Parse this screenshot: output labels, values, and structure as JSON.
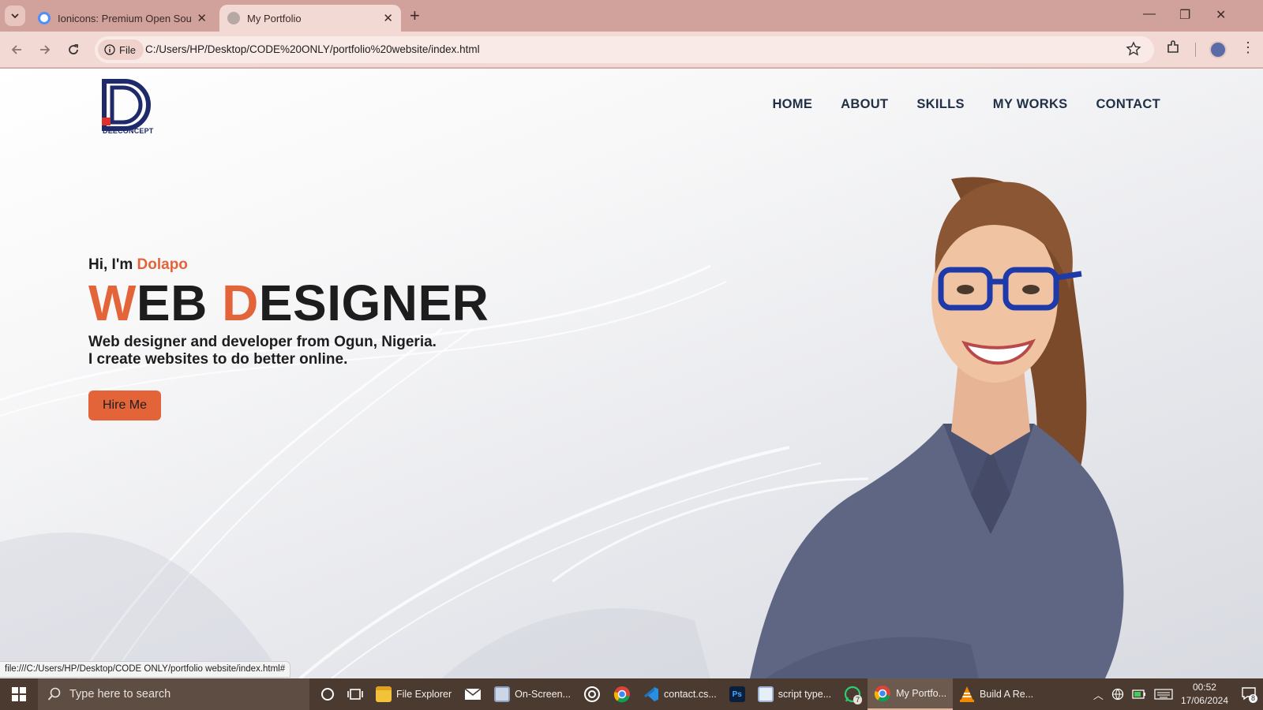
{
  "browser": {
    "tabs": [
      {
        "title": "Ionicons: Premium Open Source",
        "active": false
      },
      {
        "title": "My Portfolio",
        "active": true
      }
    ],
    "chip_label": "File",
    "url": "C:/Users/HP/Desktop/CODE%20ONLY/portfolio%20website/index.html",
    "status_url": "file:///C:/Users/HP/Desktop/CODE ONLY/portfolio website/index.html#"
  },
  "site": {
    "logo_text": "DEECONCEPT",
    "nav": [
      "HOME",
      "ABOUT",
      "SKILLS",
      "MY WORKS",
      "CONTACT"
    ],
    "greeting_prefix": "Hi, I'm ",
    "greeting_name": "Dolapo",
    "headline": {
      "w": "W",
      "eb": "EB ",
      "d": "D",
      "esigner": "ESIGNER"
    },
    "tagline_line1": "Web designer and developer from Ogun, Nigeria.",
    "tagline_line2": "I create websites to do better online.",
    "cta_label": "Hire Me",
    "accent_color": "#e4643a"
  },
  "taskbar": {
    "search_placeholder": "Type here to search",
    "apps": [
      {
        "icon": "file-explorer-icon",
        "label": "File Explorer"
      },
      {
        "icon": "mail-icon",
        "label": ""
      },
      {
        "icon": "onscreen-keyboard-icon",
        "label": "On-Screen..."
      },
      {
        "icon": "target-app-icon",
        "label": ""
      },
      {
        "icon": "chrome-icon",
        "label": ""
      },
      {
        "icon": "vscode-icon",
        "label": "contact.cs..."
      },
      {
        "icon": "photoshop-icon",
        "label": ""
      },
      {
        "icon": "word-icon",
        "label": "script type..."
      },
      {
        "icon": "whatsapp-icon",
        "label": "",
        "badge": "7"
      },
      {
        "icon": "chrome-icon",
        "label": "My Portfo..."
      },
      {
        "icon": "vlc-icon",
        "label": "Build A Re..."
      }
    ],
    "clock_time": "00:52",
    "clock_date": "17/06/2024",
    "notification_count": "8"
  }
}
